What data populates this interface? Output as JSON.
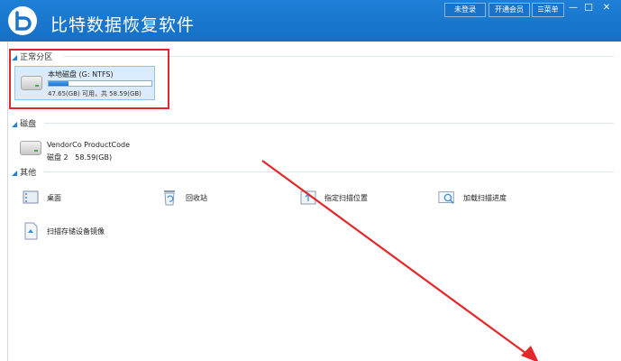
{
  "app": {
    "title": "比特数据恢复软件",
    "brand_color": "#1a74ca",
    "logo_icon": "logo-b-icon"
  },
  "titlebar_buttons": {
    "login": "未登录",
    "vip": "开通会员",
    "menu": "菜单",
    "minimize": "—",
    "close": "✕"
  },
  "sections": {
    "partitions": {
      "label": "正常分区",
      "items": [
        {
          "name": "本地磁盘 (G: NTFS)",
          "size": "47.65(GB) 可用，共 58.59(GB)",
          "usage_fraction": 0.19
        }
      ]
    },
    "disks": {
      "label": "磁盘",
      "items": [
        {
          "name": "VendorCo ProductCode",
          "info": "磁盘 2",
          "size": "58.59(GB)"
        }
      ]
    },
    "others": {
      "label": "其他",
      "items": [
        {
          "label": "桌面",
          "icon": "desktop-icon"
        },
        {
          "label": "回收站",
          "icon": "recycle-bin-icon"
        },
        {
          "label": "指定扫描位置",
          "icon": "scan-location-icon"
        },
        {
          "label": "加载扫描进度",
          "icon": "load-progress-icon"
        },
        {
          "label": "扫描存储设备镜像",
          "icon": "image-file-icon"
        }
      ]
    }
  },
  "annotation_color": "#e3272a"
}
